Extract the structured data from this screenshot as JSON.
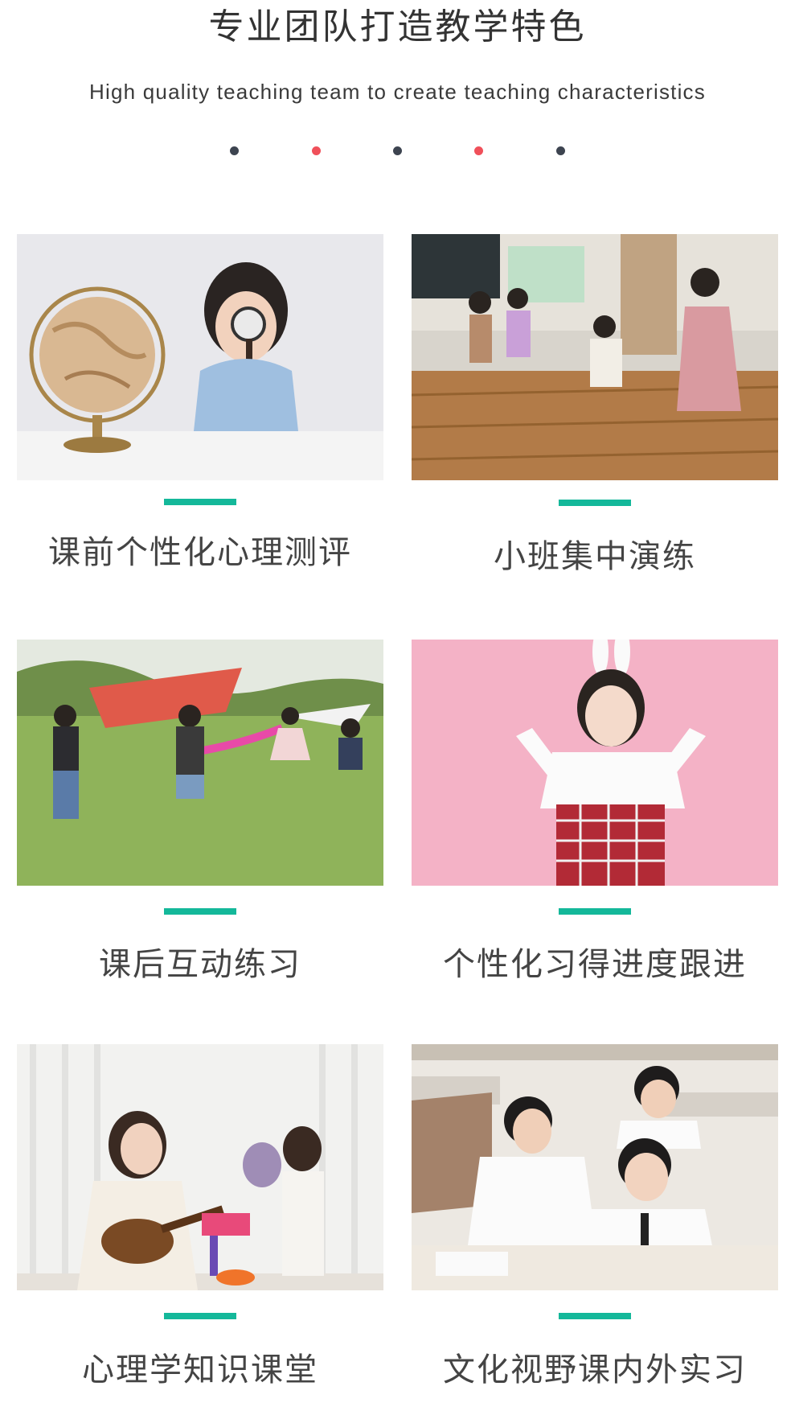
{
  "header": {
    "title": "专业团队打造教学特色",
    "subtitle": "High quality teaching team to create teaching characteristics"
  },
  "dots": [
    {
      "color": "#3d4450"
    },
    {
      "color": "#f0505a"
    },
    {
      "color": "#3d4450"
    },
    {
      "color": "#f0505a"
    },
    {
      "color": "#3d4450"
    }
  ],
  "accent_color": "#14b89a",
  "features": [
    {
      "label": "课前个性化心理测评",
      "image": "girl-with-globe-and-magnifier-photo"
    },
    {
      "label": "小班集中演练",
      "image": "children-playing-in-classroom-photo"
    },
    {
      "label": "课后互动练习",
      "image": "children-running-with-kites-photo"
    },
    {
      "label": "个性化习得进度跟进",
      "image": "girl-with-bunny-ears-on-pink-photo"
    },
    {
      "label": "心理学知识课堂",
      "image": "teacher-ukulele-with-girl-photo"
    },
    {
      "label": "文化视野课内外实习",
      "image": "students-in-classroom-photo"
    }
  ]
}
